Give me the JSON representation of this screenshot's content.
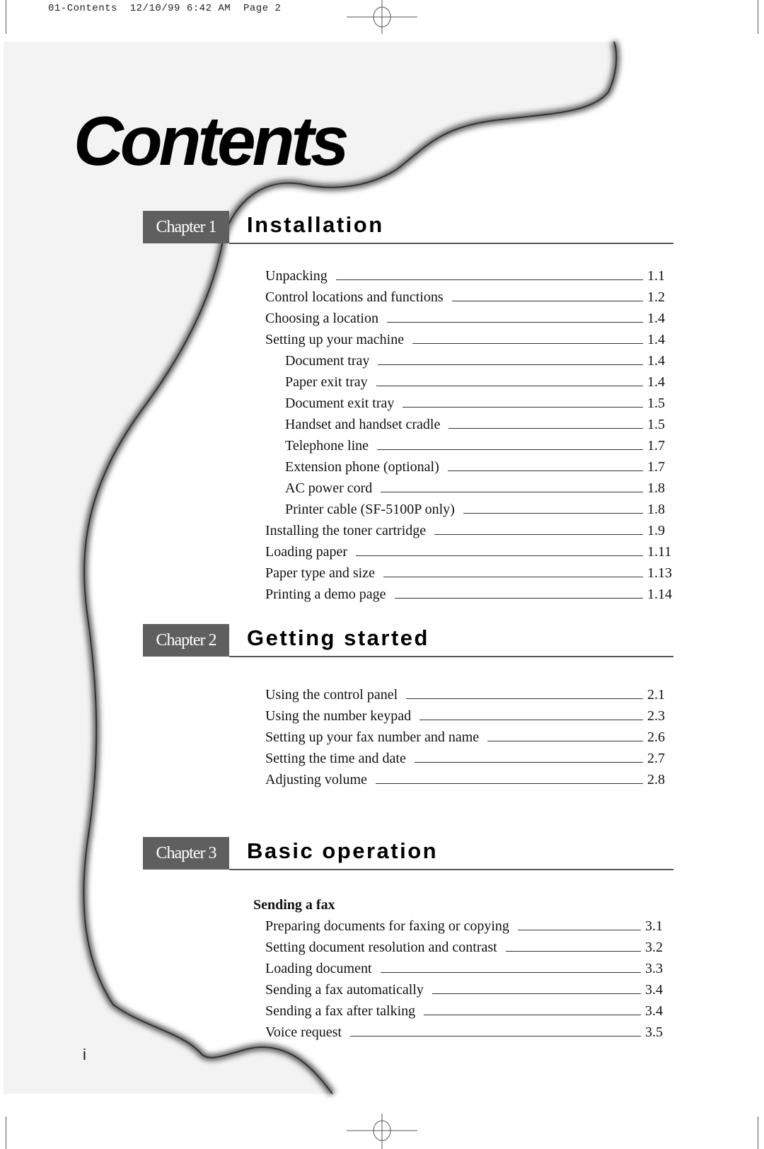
{
  "slug": {
    "file": "01-Contents",
    "date": "12/10/99",
    "time": "6:42 AM",
    "page": "Page 2"
  },
  "title": "Contents",
  "chapters": [
    {
      "tag": "Chapter 1",
      "name": "Installation",
      "entries": [
        {
          "label": "Unpacking",
          "page": "1.1",
          "level": 1
        },
        {
          "label": "Control locations and functions",
          "page": "1.2",
          "level": 1
        },
        {
          "label": "Choosing a location",
          "page": "1.4",
          "level": 1
        },
        {
          "label": "Setting up your machine",
          "page": "1.4",
          "level": 1
        },
        {
          "label": "Document tray",
          "page": "1.4",
          "level": 2
        },
        {
          "label": "Paper exit tray",
          "page": "1.4",
          "level": 2
        },
        {
          "label": "Document exit tray",
          "page": "1.5",
          "level": 2
        },
        {
          "label": "Handset and handset cradle",
          "page": "1.5",
          "level": 2
        },
        {
          "label": "Telephone line",
          "page": "1.7",
          "level": 2
        },
        {
          "label": "Extension phone (optional)",
          "page": "1.7",
          "level": 2
        },
        {
          "label": "AC power cord",
          "page": "1.8",
          "level": 2
        },
        {
          "label": "Printer cable (SF-5100P only)",
          "page": "1.8",
          "level": 2
        },
        {
          "label": "Installing the toner cartridge",
          "page": "1.9",
          "level": 1
        },
        {
          "label": "Loading paper",
          "page": "1.11",
          "level": 1
        },
        {
          "label": "Paper type and size",
          "page": "1.13",
          "level": 1
        },
        {
          "label": "Printing a demo page",
          "page": "1.14",
          "level": 1
        }
      ]
    },
    {
      "tag": "Chapter 2",
      "name": "Getting started",
      "entries": [
        {
          "label": "Using the control panel",
          "page": "2.1",
          "level": 1
        },
        {
          "label": "Using the number keypad",
          "page": "2.3",
          "level": 1
        },
        {
          "label": "Setting up your fax number and name",
          "page": "2.6",
          "level": 1
        },
        {
          "label": "Setting the time and date",
          "page": "2.7",
          "level": 1
        },
        {
          "label": "Adjusting volume",
          "page": "2.8",
          "level": 1
        }
      ]
    },
    {
      "tag": "Chapter 3",
      "name": "Basic operation",
      "section": "Sending a fax",
      "entries": [
        {
          "label": "Preparing documents for faxing or copying",
          "page": "3.1",
          "level": 1
        },
        {
          "label": "Setting document resolution and contrast",
          "page": "3.2",
          "level": 1
        },
        {
          "label": "Loading document",
          "page": "3.3",
          "level": 1
        },
        {
          "label": "Sending a fax automatically",
          "page": "3.4",
          "level": 1
        },
        {
          "label": "Sending a fax after talking",
          "page": "3.4",
          "level": 1
        },
        {
          "label": "Voice request",
          "page": "3.5",
          "level": 1
        }
      ]
    }
  ],
  "folio": "i",
  "colors": {
    "shade": "#f3f3f3",
    "chapter_tag": "#5f5f5f",
    "rule": "#555555"
  }
}
